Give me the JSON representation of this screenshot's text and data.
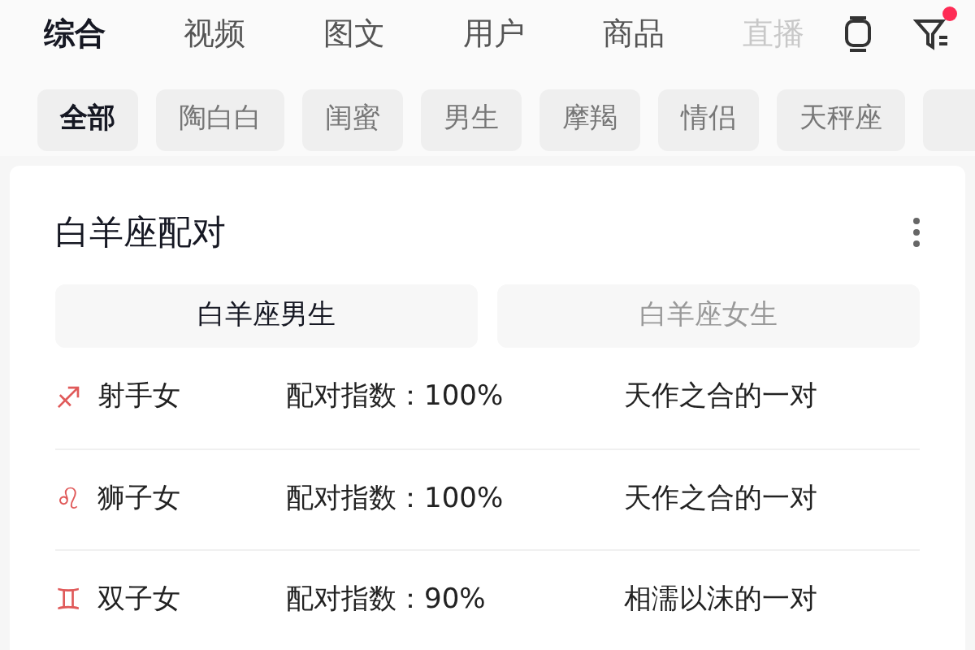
{
  "tabs": [
    {
      "label": "综合",
      "selected": true
    },
    {
      "label": "视频",
      "selected": false
    },
    {
      "label": "图文",
      "selected": false
    },
    {
      "label": "用户",
      "selected": false
    },
    {
      "label": "商品",
      "selected": false
    },
    {
      "label": "直播",
      "selected": false
    }
  ],
  "filter_badge": true,
  "chips": [
    {
      "label": "全部",
      "selected": true
    },
    {
      "label": "陶白白",
      "selected": false
    },
    {
      "label": "闺蜜",
      "selected": false
    },
    {
      "label": "男生",
      "selected": false
    },
    {
      "label": "摩羯",
      "selected": false
    },
    {
      "label": "情侣",
      "selected": false
    },
    {
      "label": "天秤座",
      "selected": false
    }
  ],
  "card": {
    "title": "白羊座配对",
    "segments": [
      {
        "label": "白羊座男生",
        "selected": true
      },
      {
        "label": "白羊座女生",
        "selected": false
      }
    ],
    "rows": [
      {
        "symbol": "♐",
        "sign": "射手女",
        "score": "配对指数：100%",
        "verdict": "天作之合的一对"
      },
      {
        "symbol": "♌",
        "sign": "狮子女",
        "score": "配对指数：100%",
        "verdict": "天作之合的一对"
      },
      {
        "symbol": "♊",
        "sign": "双子女",
        "score": "配对指数：90%",
        "verdict": "相濡以沫的一对"
      }
    ]
  }
}
